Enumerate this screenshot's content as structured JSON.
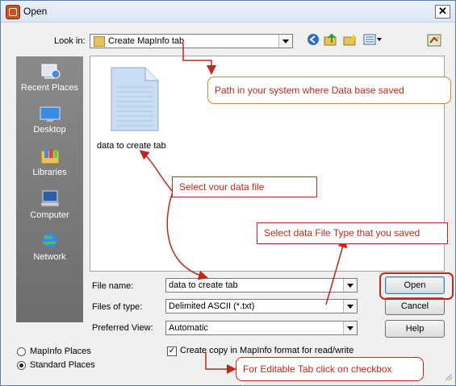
{
  "window": {
    "title": "Open",
    "close_label": "✕"
  },
  "lookin": {
    "label": "Look in:",
    "value": "Create MapInfo tab"
  },
  "toolbar_icons": [
    "back-icon",
    "up-folder-icon",
    "new-folder-icon",
    "views-menu-icon",
    "tool-icon"
  ],
  "places": [
    {
      "label": "Recent Places",
      "icon": "recent-places-icon"
    },
    {
      "label": "Desktop",
      "icon": "desktop-icon"
    },
    {
      "label": "Libraries",
      "icon": "libraries-icon"
    },
    {
      "label": "Computer",
      "icon": "computer-icon"
    },
    {
      "label": "Network",
      "icon": "network-icon"
    }
  ],
  "file": {
    "name": "data to create tab"
  },
  "fields": {
    "file_name_label": "File name:",
    "file_name_value": "data to create tab",
    "file_type_label": "Files of type:",
    "file_type_value": "Delimited ASCII (*.txt)",
    "pref_view_label": "Preferred View:",
    "pref_view_value": "Automatic"
  },
  "buttons": {
    "open": "Open",
    "cancel": "Cancel",
    "help": "Help"
  },
  "radios": {
    "mapinfo_places": "MapInfo Places",
    "standard_places": "Standard Places",
    "selected": "standard_places"
  },
  "checkbox": {
    "label": "Create copy in MapInfo format for read/write",
    "checked": true,
    "mark": "✓"
  },
  "callouts": {
    "path": "Path in your system where Data base saved",
    "select_file": "Select vour data file",
    "file_type": "Select data File Type that you saved",
    "editable": "For Editable Tab click on checkbox"
  },
  "colors": {
    "callout_red": "#c0281c",
    "callout_orange": "#d2853c"
  }
}
